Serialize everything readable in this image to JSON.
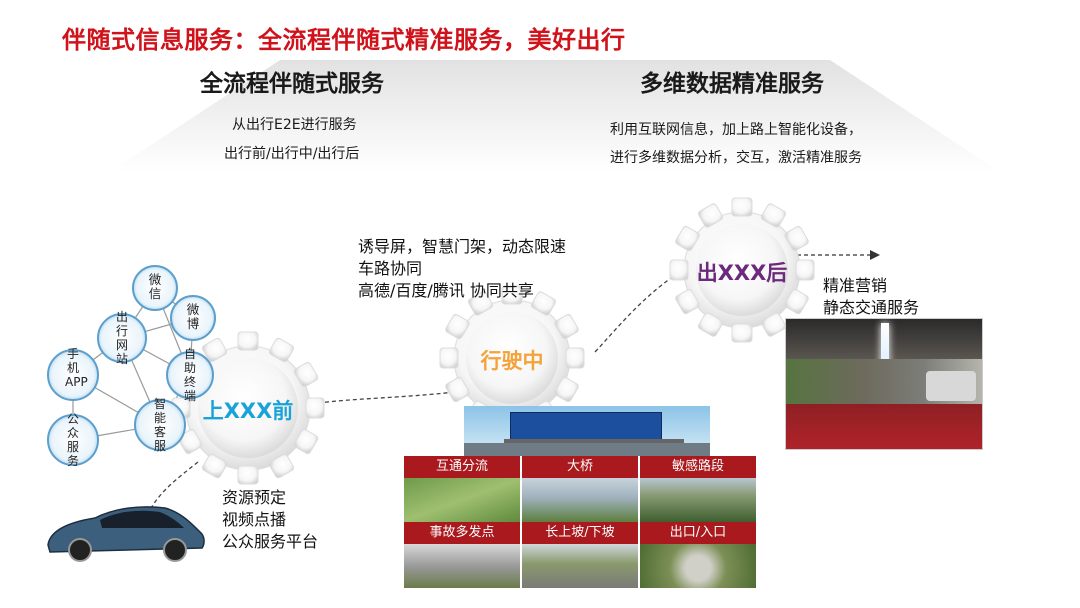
{
  "title": "伴随式信息服务：全流程伴随式精准服务，美好出行",
  "banner": {
    "left_heading": "全流程伴随式服务",
    "left_lines": [
      "从出行E2E进行服务",
      "出行前/出行中/出行后"
    ],
    "right_heading": "多维数据精准服务",
    "right_lines": [
      "利用互联网信息，加上路上智能化设备，",
      "进行多维数据分析，交互，激活精准服务"
    ]
  },
  "gears": {
    "before": "上XXX前",
    "during": "行驶中",
    "after": "出XXX后"
  },
  "notes": {
    "during": [
      "诱导屏，智慧门架，动态限速",
      "车路协同",
      "高德/百度/腾讯 协同共享"
    ],
    "after": [
      "精准营销",
      "静态交通服务"
    ],
    "before": [
      "资源预定",
      "视频点播",
      "公众服务平台"
    ]
  },
  "network": {
    "nodes": [
      "微信",
      "微博",
      "出行网站",
      "自助终端",
      "手机APP",
      "智能客服",
      "公众服务"
    ]
  },
  "photo_grid": {
    "cells": [
      "互通分流",
      "大桥",
      "敏感路段",
      "事故多发点",
      "长上坡/下坡",
      "出口/入口"
    ]
  },
  "colors": {
    "title_red": "#d0121b",
    "gear_blue": "#1aa3d8",
    "gear_orange": "#f4a23a",
    "gear_purple": "#6b2a7c",
    "grid_red": "#a9191e"
  }
}
